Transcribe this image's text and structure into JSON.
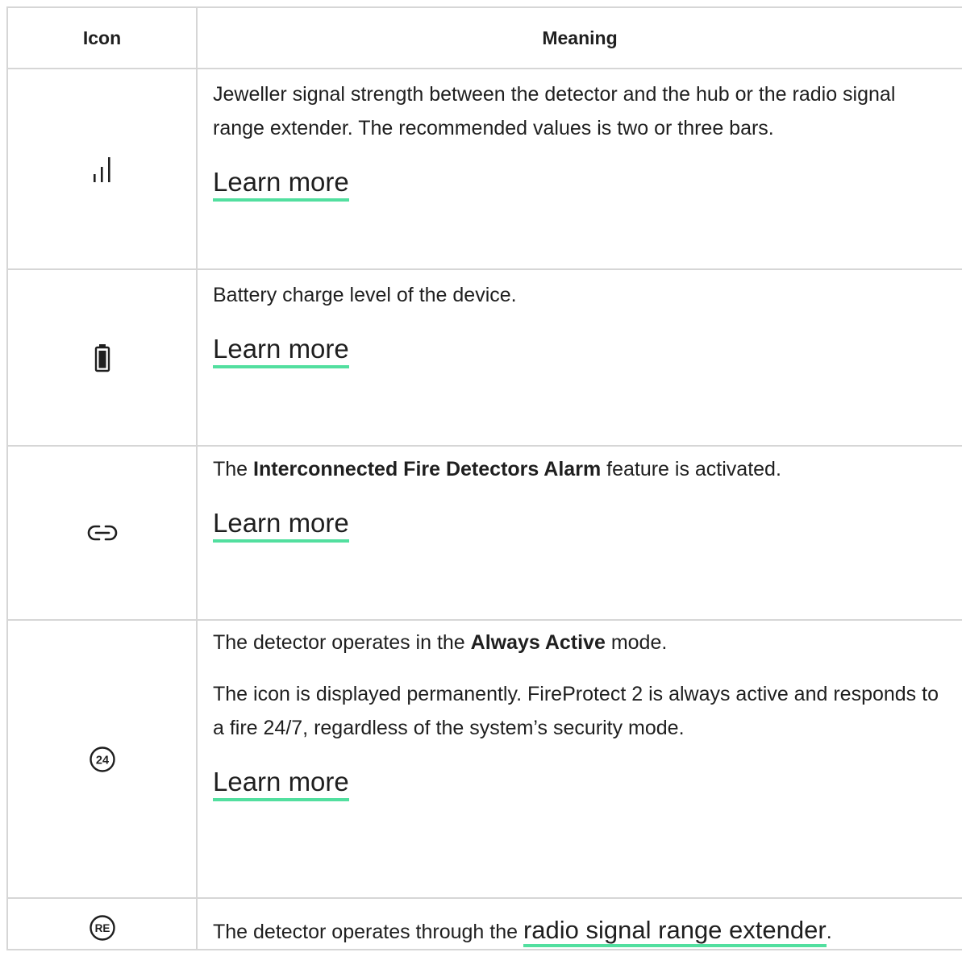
{
  "table": {
    "headers": [
      "Icon",
      "Meaning"
    ],
    "rows": [
      {
        "icon": "signal-strength-icon",
        "text": "Jeweller signal strength between the detector and the hub or the radio signal range extender. The recommended values is two or three bars.",
        "link": "Learn more"
      },
      {
        "icon": "battery-icon",
        "text": "Battery charge level of the device.",
        "link": "Learn more"
      },
      {
        "icon": "link-icon",
        "text_before": "The ",
        "text_bold": "Interconnected Fire Detectors Alarm",
        "text_after": " feature is activated.",
        "link": "Learn more"
      },
      {
        "icon": "always-active-24-icon",
        "icon_text": "24",
        "text_before": "The detector operates in the ",
        "text_bold": "Always Active",
        "text_after": " mode.",
        "text2": "The icon is displayed permanently. FireProtect 2 is always active and responds to a fire 24/7, regardless of the system’s security mode.",
        "link": "Learn more"
      },
      {
        "icon": "range-extender-icon",
        "icon_text": "RE",
        "text_before": "The detector operates through the ",
        "link": "radio signal range extender",
        "text_after": "."
      }
    ]
  },
  "colors": {
    "link_underline": "#52df9f",
    "border": "#d6d6d6",
    "text": "#1f1f1f"
  }
}
